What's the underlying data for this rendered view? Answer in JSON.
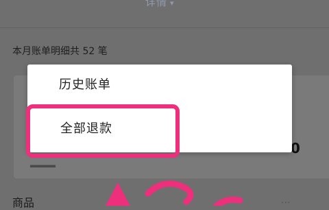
{
  "background": {
    "detail_link": "详情",
    "detail_chevron": "▾",
    "summary": "本月账单明细共 52 笔",
    "amount_fragment": "0",
    "goods_label": "商品",
    "goods_value": "..."
  },
  "menu": {
    "items": [
      {
        "label": "历史账单"
      },
      {
        "label": "全部退款"
      }
    ]
  },
  "annotation": {
    "color": "#ee2f7c"
  }
}
